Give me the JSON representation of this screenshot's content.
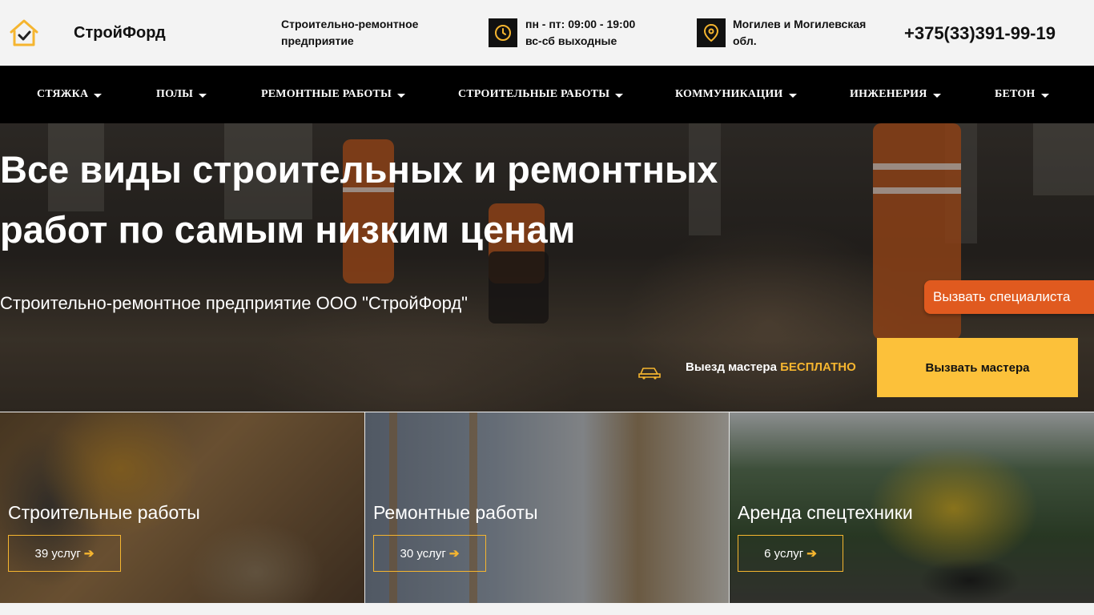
{
  "header": {
    "logo_text": "СтройФорд",
    "tagline": "Строительно-ремонтное предприятие",
    "hours_line1": "пн - пт: 09:00 - 19:00",
    "hours_line2": "вс-сб выходные",
    "location_line1": "Могилев и Могилевская",
    "location_line2": "обл.",
    "phone": "+375(33)391-99-19"
  },
  "nav": {
    "items": [
      {
        "label": "СТЯЖКА"
      },
      {
        "label": "ПОЛЫ"
      },
      {
        "label": "РЕМОНТНЫЕ РАБОТЫ"
      },
      {
        "label": "СТРОИТЕЛЬНЫЕ РАБОТЫ"
      },
      {
        "label": "КОММУНИКАЦИИ"
      },
      {
        "label": "ИНЖЕНЕРИЯ"
      },
      {
        "label": "БЕТОН"
      }
    ]
  },
  "hero": {
    "title_line1": "Все виды строительных и ремонтных",
    "title_line2": "работ по самым низким ценам",
    "subtitle": "Строительно-ремонтное предприятие ООО \"СтройФорд\"",
    "call_specialist": "Вызвать специалиста",
    "free_visit_prefix": "Выезд мастера",
    "free_visit_accent": "БЕСПЛАТНО",
    "call_master": "Вызвать мастера"
  },
  "cards": [
    {
      "title": "Строительные работы",
      "button": "39 услуг"
    },
    {
      "title": "Ремонтные работы",
      "button": "30 услуг"
    },
    {
      "title": "Аренда спецтехники",
      "button": "6 услуг"
    }
  ],
  "colors": {
    "accent": "#fcc13a",
    "orange_button": "#e05a1f",
    "nav_bg": "#000000",
    "header_bg": "#f3f3f3"
  }
}
